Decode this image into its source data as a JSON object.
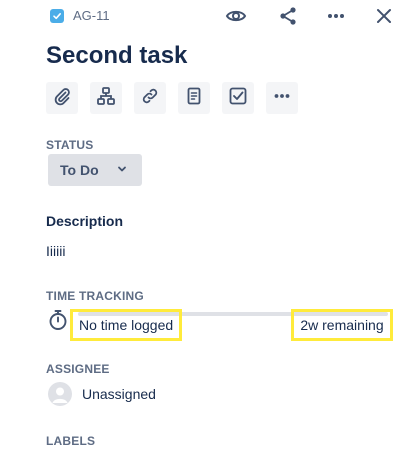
{
  "header": {
    "issue_key": "AG-11",
    "actions": [
      {
        "name": "watch",
        "icon": "eye-icon"
      },
      {
        "name": "share",
        "icon": "share-icon"
      },
      {
        "name": "more",
        "icon": "more-icon"
      },
      {
        "name": "close",
        "icon": "close-icon"
      }
    ]
  },
  "issue": {
    "title": "Second task"
  },
  "toolbar": [
    {
      "name": "attach",
      "icon": "paperclip-icon"
    },
    {
      "name": "child-issue",
      "icon": "hierarchy-icon"
    },
    {
      "name": "link-issue",
      "icon": "link-icon"
    },
    {
      "name": "page",
      "icon": "document-icon"
    },
    {
      "name": "checklist",
      "icon": "checkbox-icon"
    },
    {
      "name": "more",
      "icon": "more-icon"
    }
  ],
  "status": {
    "label": "STATUS",
    "value": "To Do"
  },
  "description": {
    "label": "Description",
    "value": "Iiiiii"
  },
  "time_tracking": {
    "label": "TIME TRACKING",
    "logged": "No time logged",
    "remaining": "2w remaining",
    "progress": 0
  },
  "assignee": {
    "label": "ASSIGNEE",
    "value": "Unassigned"
  },
  "labels": {
    "label": "LABELS"
  },
  "colors": {
    "text_primary": "#172b4d",
    "text_secondary": "#5e6c84",
    "highlight": "#ffeb3b",
    "button_bg": "#f4f5f7",
    "status_bg": "#dfe1e6",
    "issue_type": "#4bade8"
  }
}
